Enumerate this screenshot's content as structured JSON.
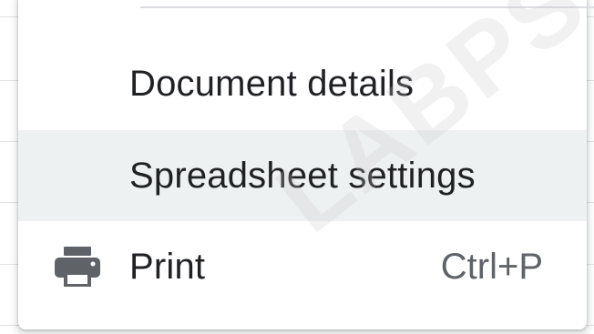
{
  "menu": {
    "items": [
      {
        "label": "Document details",
        "shortcut": ""
      },
      {
        "label": "Spreadsheet settings",
        "shortcut": ""
      },
      {
        "label": "Print",
        "shortcut": "Ctrl+P",
        "icon": "print-icon"
      }
    ],
    "hovered_index": 1
  },
  "watermark": {
    "text": "LABPSYCHI"
  },
  "colors": {
    "hover_bg": "#eef1f2",
    "text": "#202124",
    "shortcut_text": "#5f6368",
    "icon": "#5f6368"
  }
}
